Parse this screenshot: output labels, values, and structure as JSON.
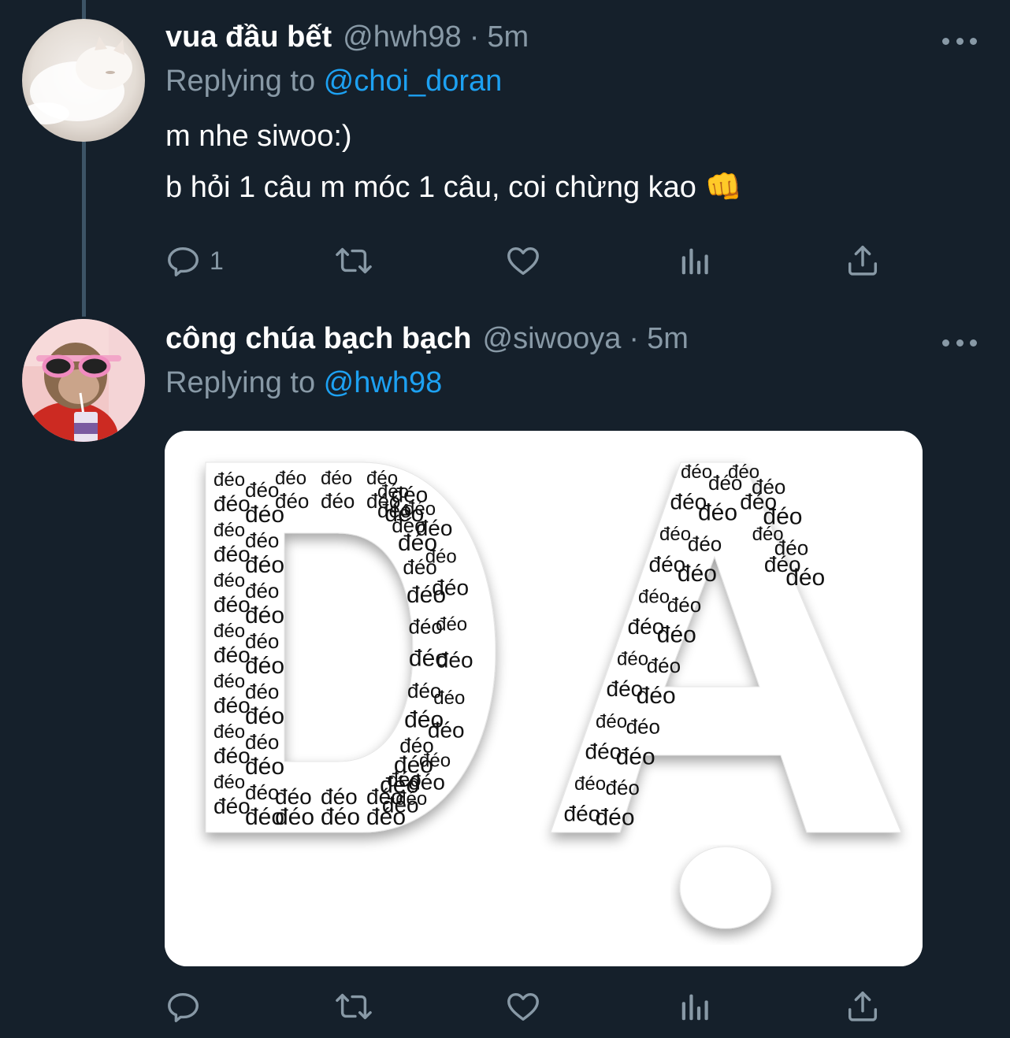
{
  "tweets": [
    {
      "display_name": "vua đầu bết",
      "handle": "@hwh98",
      "separator": "·",
      "time": "5m",
      "replying_prefix": "Replying to ",
      "replying_to": "@choi_doran",
      "text_lines": [
        "m nhe siwoo:)",
        "b hỏi 1 câu m móc 1 câu, coi chừng kao 👊"
      ],
      "reply_count": "1"
    },
    {
      "display_name": "công chúa bạch bạch",
      "handle": "@siwooya",
      "separator": "·",
      "time": "5m",
      "replying_prefix": "Replying to ",
      "replying_to": "@hwh98",
      "media_words": [
        "đéo",
        "đéo",
        "đéo",
        "đéo",
        "đéo",
        "đéo",
        "đéo",
        "đéo",
        "đéo",
        "đéo",
        "đéo",
        "đéo",
        "đéo",
        "đéo",
        "đéo",
        "đéo",
        "đéo",
        "đéo",
        "đéo",
        "đéo",
        "đéo",
        "đéo",
        "đéo",
        "đéo",
        "đéo",
        "đéo",
        "đéo",
        "đéo",
        "đéo",
        "đéo",
        "đéo",
        "đéo",
        "đéo",
        "đéo",
        "đéo",
        "đéo",
        "đéo",
        "đéo",
        "đéo",
        "đéo",
        "đéo",
        "đéo",
        "đéo",
        "đéo",
        "đéo",
        "đéo",
        "đéo",
        "đéo",
        "đéo",
        "đéo",
        "đéo",
        "đéo",
        "đéo",
        "đéo",
        "đéo",
        "đéo",
        "đéo",
        "đéo",
        "đéo",
        "đéo",
        "đéo",
        "đéo",
        "đéo",
        "đéo",
        "đéo",
        "đéo",
        "đéo",
        "đéo",
        "đéo",
        "đéo",
        "đéo",
        "đéo",
        "đéo",
        "đéo",
        "đéo",
        "đéo",
        "đéo",
        "đéo",
        "đéo",
        "đéo",
        "đéo",
        "đéo",
        "đéo",
        "đéo",
        "đéo",
        "đéo",
        "đéo",
        "đéo",
        "đéo",
        "đéo",
        "đéo",
        "đéo",
        "đéo",
        "đéo",
        "đéo",
        "đéo",
        "đéo",
        "đéo",
        "đéo",
        "đéo"
      ]
    }
  ],
  "icons": {
    "reply": "reply-icon",
    "retweet": "retweet-icon",
    "like": "heart-icon",
    "analytics": "analytics-icon",
    "share": "share-icon",
    "more": "more-icon"
  },
  "colors": {
    "background": "#15202b",
    "secondary_text": "#8899a6",
    "link": "#1da1f2",
    "thread_line": "#3d5466"
  }
}
